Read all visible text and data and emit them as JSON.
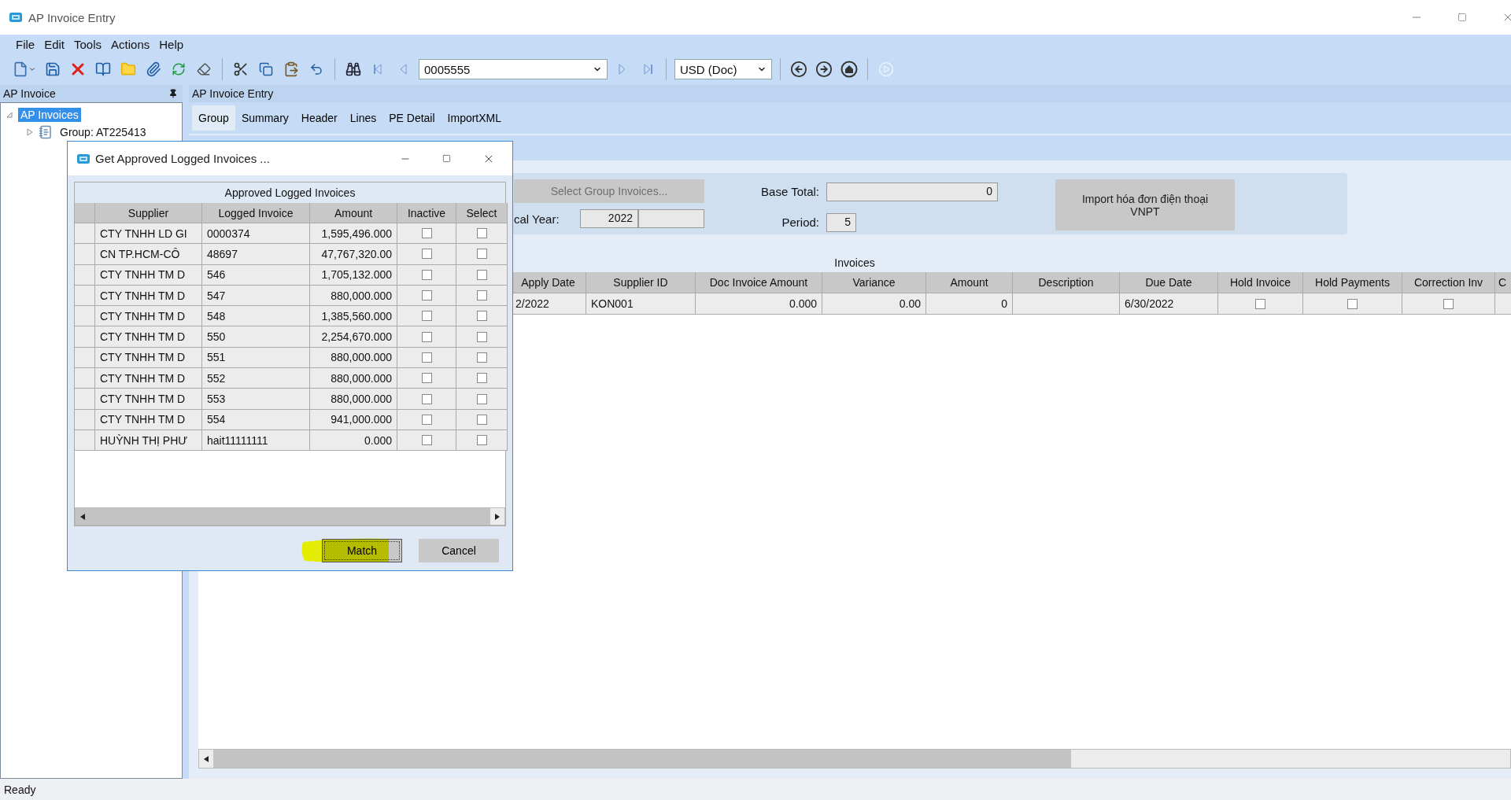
{
  "window": {
    "title": "AP Invoice Entry"
  },
  "menu": [
    "File",
    "Edit",
    "Tools",
    "Actions",
    "Help"
  ],
  "toolbar": {
    "record_field": "0005555",
    "currency_field": "USD (Doc)"
  },
  "side_panel": {
    "title": "AP Invoice",
    "tree": [
      {
        "label": "AP Invoices",
        "selected": true,
        "expanded": true,
        "children": [
          {
            "label": "Group: AT225413",
            "selected": false,
            "expanded": false
          }
        ]
      }
    ]
  },
  "main": {
    "title": "AP Invoice Entry",
    "tabs": [
      {
        "label": "Group",
        "selected": true
      },
      {
        "label": "Summary",
        "selected": false
      },
      {
        "label": "Header",
        "selected": false
      },
      {
        "label": "Lines",
        "selected": false
      },
      {
        "label": "PE Detail",
        "selected": false
      },
      {
        "label": "ImportXML",
        "selected": false
      }
    ],
    "form": {
      "select_group_button": {
        "label": "Select Group Invoices...",
        "disabled": true
      },
      "fiscal_year_label": "cal Year:",
      "fiscal_year": "2022",
      "base_total_label": "Base Total:",
      "base_total": "0",
      "period_label": "Period:",
      "period": "5",
      "import_button": "Import hóa đơn điện thoại VNPT"
    },
    "invoices": {
      "title": "Invoices",
      "columns": [
        "Apply Date",
        "Supplier ID",
        "Doc Invoice Amount",
        "Variance",
        "Amount",
        "Description",
        "Due Date",
        "Hold Invoice",
        "Hold Payments",
        "Correction Inv",
        "C"
      ],
      "rows": [
        {
          "apply_date": "2/2022",
          "supplier_id": "KON001",
          "doc_invoice_amount": "0.000",
          "variance": "0.00",
          "amount": "0",
          "due_date": "6/30/2022",
          "hold_invoice": false,
          "hold_payments": false,
          "correction_inv": false
        }
      ]
    }
  },
  "dialog": {
    "title": "Get Approved Logged Invoices ...",
    "table": {
      "title": "Approved Logged Invoices",
      "columns": [
        "Supplier",
        "Logged Invoice",
        "Amount",
        "Inactive",
        "Select"
      ],
      "rows": [
        {
          "supplier": "CTY TNHH LD GI",
          "logged_invoice": "0000374",
          "amount": "1,595,496.000",
          "inactive": false,
          "select": false
        },
        {
          "supplier": "CN TP.HCM-CÔ",
          "logged_invoice": "48697",
          "amount": "47,767,320.00",
          "inactive": false,
          "select": false
        },
        {
          "supplier": "CTY TNHH TM D",
          "logged_invoice": "546",
          "amount": "1,705,132.000",
          "inactive": false,
          "select": false
        },
        {
          "supplier": "CTY TNHH TM D",
          "logged_invoice": "547",
          "amount": "880,000.000",
          "inactive": false,
          "select": false
        },
        {
          "supplier": "CTY TNHH TM D",
          "logged_invoice": "548",
          "amount": "1,385,560.000",
          "inactive": false,
          "select": false
        },
        {
          "supplier": "CTY TNHH TM D",
          "logged_invoice": "550",
          "amount": "2,254,670.000",
          "inactive": false,
          "select": false
        },
        {
          "supplier": "CTY TNHH TM D",
          "logged_invoice": "551",
          "amount": "880,000.000",
          "inactive": false,
          "select": false
        },
        {
          "supplier": "CTY TNHH TM D",
          "logged_invoice": "552",
          "amount": "880,000.000",
          "inactive": false,
          "select": false
        },
        {
          "supplier": "CTY TNHH TM D",
          "logged_invoice": "553",
          "amount": "880,000.000",
          "inactive": false,
          "select": false
        },
        {
          "supplier": "CTY TNHH TM D",
          "logged_invoice": "554",
          "amount": "941,000.000",
          "inactive": false,
          "select": false
        },
        {
          "supplier": "HUỲNH THỊ PHƯ",
          "logged_invoice": "hait11111111",
          "amount": "0.000",
          "inactive": false,
          "select": false
        }
      ]
    },
    "buttons": [
      {
        "label": "Match",
        "focused": true,
        "highlighted": true
      },
      {
        "label": "Cancel",
        "focused": false,
        "highlighted": false
      }
    ]
  },
  "status_bar": "Ready"
}
